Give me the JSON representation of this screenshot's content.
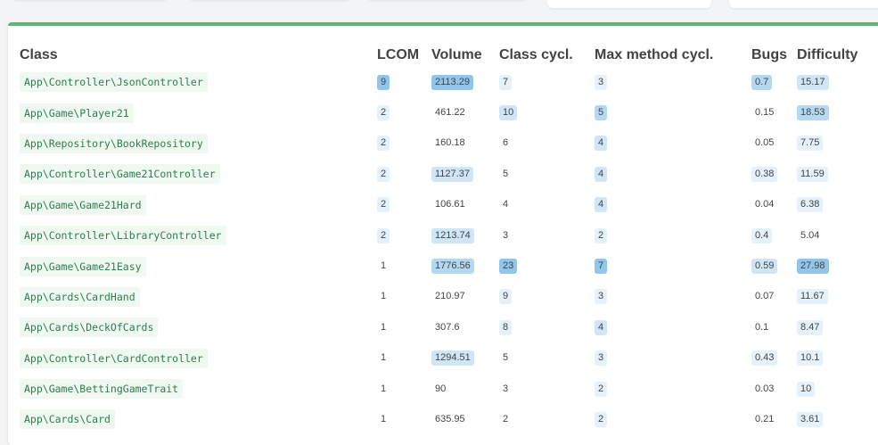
{
  "table": {
    "headers": [
      "Class",
      "LCOM",
      "Volume",
      "Class cycl.",
      "Max method cycl.",
      "Bugs",
      "Difficulty"
    ],
    "rows": [
      {
        "class": "App\\Controller\\JsonController",
        "lcom": "9",
        "volume": "2113.29",
        "ccycl": "7",
        "mcycl": "3",
        "bugs": "0.7",
        "difficulty": "15.17",
        "w": [
          4,
          4,
          1,
          1,
          3,
          2
        ]
      },
      {
        "class": "App\\Game\\Player21",
        "lcom": "2",
        "volume": "461.22",
        "ccycl": "10",
        "mcycl": "5",
        "bugs": "0.15",
        "difficulty": "18.53",
        "w": [
          1,
          0,
          2,
          3,
          0,
          3
        ]
      },
      {
        "class": "App\\Repository\\BookRepository",
        "lcom": "2",
        "volume": "160.18",
        "ccycl": "6",
        "mcycl": "4",
        "bugs": "0.05",
        "difficulty": "7.75",
        "w": [
          1,
          0,
          0,
          2,
          0,
          1
        ]
      },
      {
        "class": "App\\Controller\\Game21Controller",
        "lcom": "2",
        "volume": "1127.37",
        "ccycl": "5",
        "mcycl": "4",
        "bugs": "0.38",
        "difficulty": "11.59",
        "w": [
          1,
          2,
          0,
          2,
          1,
          1
        ]
      },
      {
        "class": "App\\Game\\Game21Hard",
        "lcom": "2",
        "volume": "106.61",
        "ccycl": "4",
        "mcycl": "4",
        "bugs": "0.04",
        "difficulty": "6.38",
        "w": [
          1,
          0,
          0,
          2,
          0,
          1
        ]
      },
      {
        "class": "App\\Controller\\LibraryController",
        "lcom": "2",
        "volume": "1213.74",
        "ccycl": "3",
        "mcycl": "2",
        "bugs": "0.4",
        "difficulty": "5.04",
        "w": [
          1,
          2,
          0,
          1,
          1,
          0
        ]
      },
      {
        "class": "App\\Game\\Game21Easy",
        "lcom": "1",
        "volume": "1776.56",
        "ccycl": "23",
        "mcycl": "7",
        "bugs": "0.59",
        "difficulty": "27.98",
        "w": [
          0,
          3,
          4,
          4,
          2,
          4
        ]
      },
      {
        "class": "App\\Cards\\CardHand",
        "lcom": "1",
        "volume": "210.97",
        "ccycl": "9",
        "mcycl": "3",
        "bugs": "0.07",
        "difficulty": "11.67",
        "w": [
          0,
          0,
          1,
          1,
          0,
          1
        ]
      },
      {
        "class": "App\\Cards\\DeckOfCards",
        "lcom": "1",
        "volume": "307.6",
        "ccycl": "8",
        "mcycl": "4",
        "bugs": "0.1",
        "difficulty": "8.47",
        "w": [
          0,
          0,
          1,
          2,
          0,
          1
        ]
      },
      {
        "class": "App\\Controller\\CardController",
        "lcom": "1",
        "volume": "1294.51",
        "ccycl": "5",
        "mcycl": "3",
        "bugs": "0.43",
        "difficulty": "10.1",
        "w": [
          0,
          2,
          0,
          1,
          1,
          1
        ]
      },
      {
        "class": "App\\Game\\BettingGameTrait",
        "lcom": "1",
        "volume": "90",
        "ccycl": "3",
        "mcycl": "2",
        "bugs": "0.03",
        "difficulty": "10",
        "w": [
          0,
          0,
          0,
          1,
          0,
          1
        ]
      },
      {
        "class": "App\\Cards\\Card",
        "lcom": "1",
        "volume": "635.95",
        "ccycl": "2",
        "mcycl": "2",
        "bugs": "0.21",
        "difficulty": "3.61",
        "w": [
          0,
          0,
          0,
          1,
          0,
          1
        ]
      }
    ]
  }
}
